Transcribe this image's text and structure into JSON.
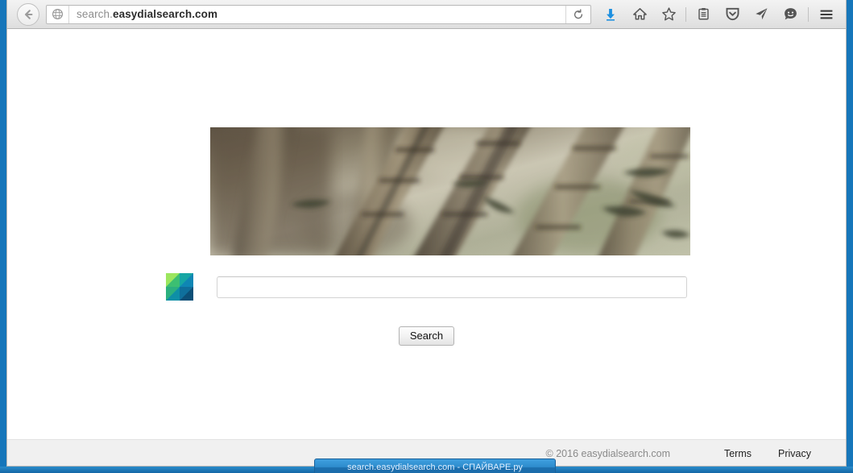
{
  "browser": {
    "back_icon": "back-arrow-icon",
    "urlbar": {
      "identity_icon": "globe-icon",
      "url_prefix": "search.",
      "url_domain": "easydialsearch.com",
      "url_full": "search.easydialsearch.com",
      "reload_icon": "reload-icon"
    },
    "toolbar_icons": [
      {
        "name": "downloads-icon",
        "glyph": "download-arrow",
        "color": "#1e90e0"
      },
      {
        "name": "home-icon",
        "glyph": "house",
        "color": "#4d4d4d"
      },
      {
        "name": "bookmark-star-icon",
        "glyph": "star-outline",
        "color": "#4d4d4d"
      },
      {
        "name": "reader-list-icon",
        "glyph": "clipboard",
        "color": "#4d4d4d"
      },
      {
        "name": "pocket-icon",
        "glyph": "shield-chevron",
        "color": "#4d4d4d"
      },
      {
        "name": "send-icon",
        "glyph": "paper-plane",
        "color": "#4d4d4d"
      },
      {
        "name": "feedback-icon",
        "glyph": "smiley-face",
        "color": "#4d4d4d"
      },
      {
        "name": "menu-icon",
        "glyph": "hamburger",
        "color": "#3a3a3a"
      }
    ]
  },
  "page": {
    "hero": {
      "name": "bamboo-hero-image",
      "alt": "Blurred bamboo forest photograph"
    },
    "logo": {
      "name": "easydialsearch-logo",
      "colors": [
        "#8fe05a",
        "#3fbf7f",
        "#1f9d90",
        "#0f7fa8",
        "#0e6f9e",
        "#0d4f79",
        "#17a0a8",
        "#1a86b8"
      ]
    },
    "search": {
      "input_value": "",
      "input_placeholder": "",
      "button_label": "Search"
    }
  },
  "footer": {
    "copyright": "© 2016 easydialsearch.com",
    "links": [
      {
        "label": "Terms"
      },
      {
        "label": "Privacy"
      }
    ]
  },
  "taskbar": {
    "item_label": "search.easydialsearch.com - СПАЙВАРЕ.ру"
  }
}
